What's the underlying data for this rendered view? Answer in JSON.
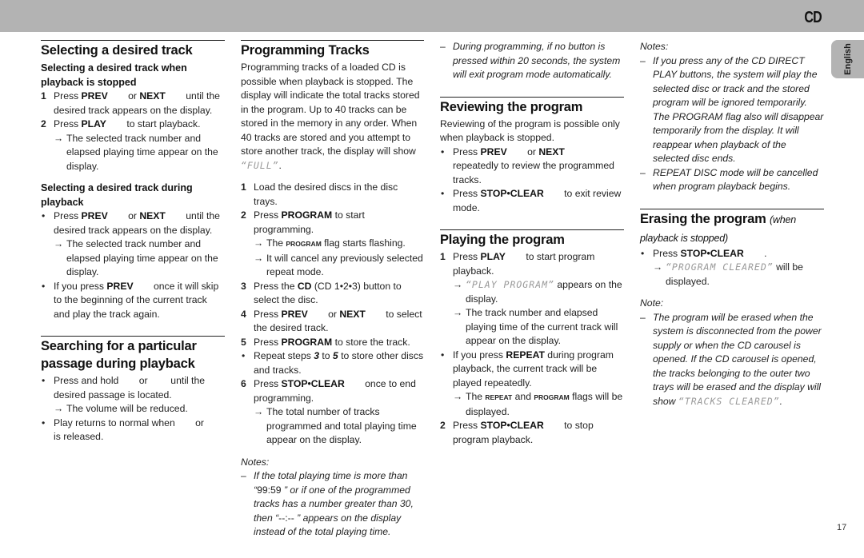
{
  "header": {
    "section": "CD",
    "language_tab": "English",
    "page_number": "17"
  },
  "col1": {
    "title": "Selecting a desired track",
    "sub1": {
      "heading": "Selecting a desired track when playback is stopped",
      "step1": {
        "num": "1",
        "pre": "Press ",
        "k1": "PREV",
        "mid": " or ",
        "k2": "NEXT",
        "post": " until the desired track appears on the display."
      },
      "step2": {
        "num": "2",
        "pre": "Press ",
        "k1": "PLAY",
        "post": " to start playback."
      },
      "result": "The selected track number and elapsed playing time appear on the display."
    },
    "sub2": {
      "heading": "Selecting a desired track during playback",
      "b1": {
        "pre": "Press ",
        "k1": "PREV",
        "mid": " or ",
        "k2": "NEXT",
        "post": " until the desired track appears on the display."
      },
      "result": "The selected track number and elapsed playing time appear on the display.",
      "b2": {
        "pre": "If you press ",
        "k1": "PREV",
        "post": " once it will skip to the beginning of the current track and play the track again."
      }
    },
    "search": {
      "title": "Searching for a particular passage during playback",
      "b1": {
        "pre": "Press and hold",
        "mid": " or ",
        "post": " until the desired passage is located."
      },
      "result": "The volume will be reduced.",
      "b2": {
        "pre": "Play returns to normal when",
        "mid": " or ",
        "post": "is released."
      }
    }
  },
  "col2": {
    "title": "Programming Tracks",
    "intro": "Programming tracks of a loaded CD is possible when playback is stopped. The display will indicate the total tracks stored in the program. Up to 40 tracks can be stored in the memory in any order. When 40 tracks are stored and you attempt to store another track, the display will show",
    "intro_lcd": "“FULL”",
    "s1": {
      "num": "1",
      "text": "Load the desired discs in the disc trays."
    },
    "s2": {
      "num": "2",
      "pre": "Press ",
      "k1": "PROGRAM",
      "post": " to start programming."
    },
    "s2r1": {
      "pre": "The ",
      "flag": "PROGRAM",
      "post": " flag starts flashing."
    },
    "s2r2": "It will cancel any previously selected repeat mode.",
    "s3": {
      "num": "3",
      "pre": "Press the ",
      "k1": "CD",
      "post": " (CD 1•2•3) button to select the disc."
    },
    "s4": {
      "num": "4",
      "pre": "Press ",
      "k1": "PREV",
      "mid": " or ",
      "k2": "NEXT",
      "post": " to select the desired track."
    },
    "s5": {
      "num": "5",
      "pre": "Press ",
      "k1": "PROGRAM",
      "post": " to store the track."
    },
    "rep": {
      "pre": "Repeat steps ",
      "a": "3",
      "mid": " to ",
      "b": "5",
      "post": " to store other discs and tracks."
    },
    "s6": {
      "num": "6",
      "pre": "Press ",
      "k1": "STOP•CLEAR",
      "post": " once to end programming."
    },
    "s6r": "The total number of tracks programmed and total playing time appear on the display.",
    "notes_label": "Notes:",
    "note1": {
      "pre": "If the total playing time is more than “",
      "v1": "99:59",
      "mid": " ” or if one of the programmed tracks has a number greater than 30, then “",
      "v2": "--:--",
      "post": " ” appears on the display instead of the total playing time."
    }
  },
  "col3": {
    "note2": "During programming,  if no button is pressed within 20 seconds, the system will exit program mode automatically.",
    "review": {
      "title": "Reviewing the program",
      "intro": "Reviewing of the program is possible only when playback is stopped.",
      "b1": {
        "pre": "Press ",
        "k1": "PREV",
        "mid": " or ",
        "k2": "NEXT",
        "post": " repeatedly to review the programmed tracks."
      },
      "b2": {
        "pre": "Press ",
        "k1": "STOP•CLEAR",
        "post": " to exit review mode."
      }
    },
    "play": {
      "title": "Playing the program",
      "s1": {
        "num": "1",
        "pre": "Press ",
        "k1": "PLAY",
        "post": " to start program playback."
      },
      "r1": {
        "lcd": "“PLAY PROGRAM”",
        "post": " appears on the display."
      },
      "r2": "The track number and elapsed playing time of the current track will appear on the display.",
      "b1": {
        "pre": "If you press ",
        "k1": "REPEAT",
        "post": " during program playback, the current track will be played repeatedly."
      },
      "r3": {
        "pre": "The ",
        "f1": "REPEAT",
        "mid": " and ",
        "f2": "PROGRAM",
        "post": " flags will be displayed."
      },
      "s2": {
        "num": "2",
        "pre": "Press ",
        "k1": "STOP•CLEAR",
        "post": " to stop program playback."
      }
    }
  },
  "col4": {
    "notes_label": "Notes:",
    "n1": "If you press any of the CD DIRECT PLAY buttons, the system will play the selected disc or track and the stored program will be ignored temporarily. The PROGRAM flag also will disappear temporarily from the display. It will reappear when playback of the selected disc ends.",
    "n2": "REPEAT DISC mode will be cancelled when program playback begins.",
    "erase": {
      "title": "Erasing the program",
      "title_sub": "(when playback is stopped)",
      "b1": {
        "pre": "Press ",
        "k1": "STOP•CLEAR",
        "post": " ."
      },
      "r1": {
        "lcd": "“PROGRAM CLEARED”",
        "post": " will be displayed."
      },
      "note_label": "Note:",
      "note": {
        "pre": "The program will be erased when the system is disconnected from the power supply or when the CD carousel is opened.  If the CD carousel is opened, the tracks belonging to the outer two trays will be erased and the display will show ",
        "lcd": "“TRACKS CLEARED”",
        "post": "."
      }
    }
  }
}
